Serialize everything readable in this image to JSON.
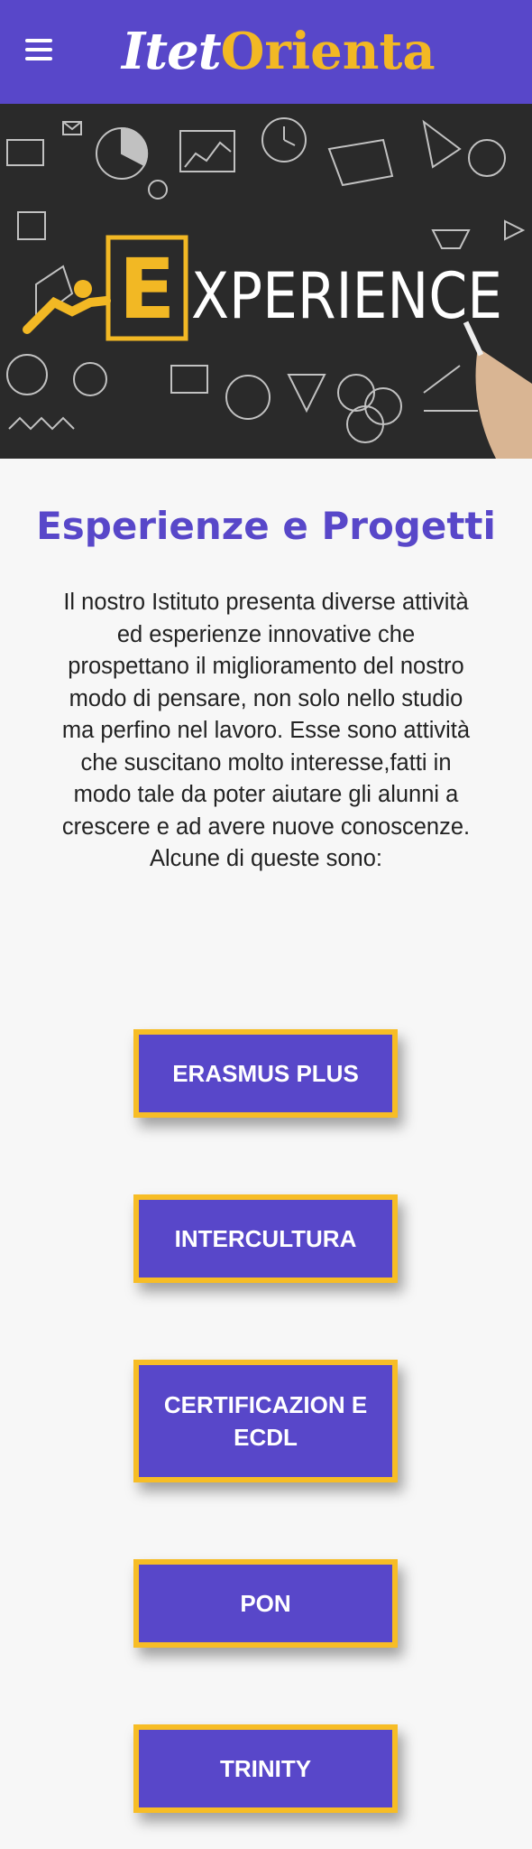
{
  "header": {
    "menu_icon": "hamburger-menu-icon",
    "logo_part1": "Itet",
    "logo_part2": "Orienta",
    "brand_color": "#5847c9",
    "accent_color": "#f2b824"
  },
  "hero": {
    "image_text": "EXPERIENCE",
    "letter_in_box": "E",
    "rest": "XPERIENCE"
  },
  "main": {
    "title": "Esperienze e Progetti",
    "intro": "Il nostro Istituto presenta diverse attività ed esperienze innovative che prospettano il miglioramento del nostro modo di pensare, non solo nello studio ma perfino nel lavoro. Esse sono attività che suscitano molto interesse,fatti in modo tale da poter aiutare gli alunni a crescere e ad avere nuove conoscenze. Alcune di queste sono:",
    "buttons": [
      {
        "label": "ERASMUS PLUS"
      },
      {
        "label": "INTERCULTURA"
      },
      {
        "label": "CERTIFICAZION E ECDL"
      },
      {
        "label": "PON"
      },
      {
        "label": "TRINITY"
      }
    ]
  }
}
